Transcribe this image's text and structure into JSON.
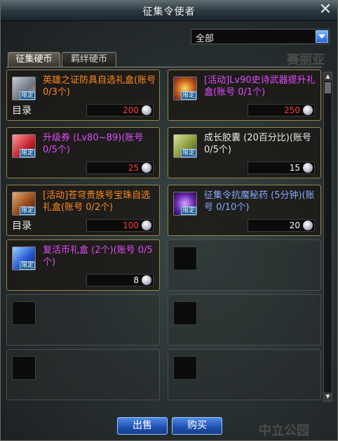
{
  "window": {
    "title": "征集令使者",
    "close_label": "✕"
  },
  "filter": {
    "selected": "全部"
  },
  "tabs": [
    {
      "label": "征集硬币"
    },
    {
      "label": "羁绊硬币"
    }
  ],
  "background_text": [
    "赛丽亚",
    "中立公园"
  ],
  "items": [
    {
      "name": "英雄之证防具自选礼盒(账号 0/3个)",
      "color": "orange",
      "price": "200",
      "price_color": "red",
      "catalog": "目录",
      "badge": "限定"
    },
    {
      "name": "[活动]Lv90史诗武器提升礼盒(账号 0/1个)",
      "color": "purple",
      "price": "250",
      "price_color": "red",
      "catalog": "",
      "badge": "限定"
    },
    {
      "name": "升级券 (Lv80~89)(账号 0/5个)",
      "color": "purple",
      "price": "25",
      "price_color": "red",
      "catalog": "",
      "badge": "限定"
    },
    {
      "name": "成长胶囊 (20百分比)(账号 0/5个)",
      "color": "white",
      "price": "15",
      "price_color": "white",
      "catalog": "",
      "badge": "限定"
    },
    {
      "name": "[活动]苍穹贵族号宝珠自选礼盒(账号 0/2个)",
      "color": "orange",
      "price": "100",
      "price_color": "red",
      "catalog": "目录",
      "badge": "限定"
    },
    {
      "name": "征集令抗魔秘药 (5分钟)(账号 0/10个)",
      "color": "blue",
      "price": "20",
      "price_color": "white",
      "catalog": "",
      "badge": "限定"
    },
    {
      "name": "复活币礼盒 (2个)(账号 0/5个)",
      "color": "purple",
      "price": "8",
      "price_color": "white",
      "catalog": "",
      "badge": "限定"
    }
  ],
  "buttons": {
    "sell": "出售",
    "buy": "购买"
  }
}
